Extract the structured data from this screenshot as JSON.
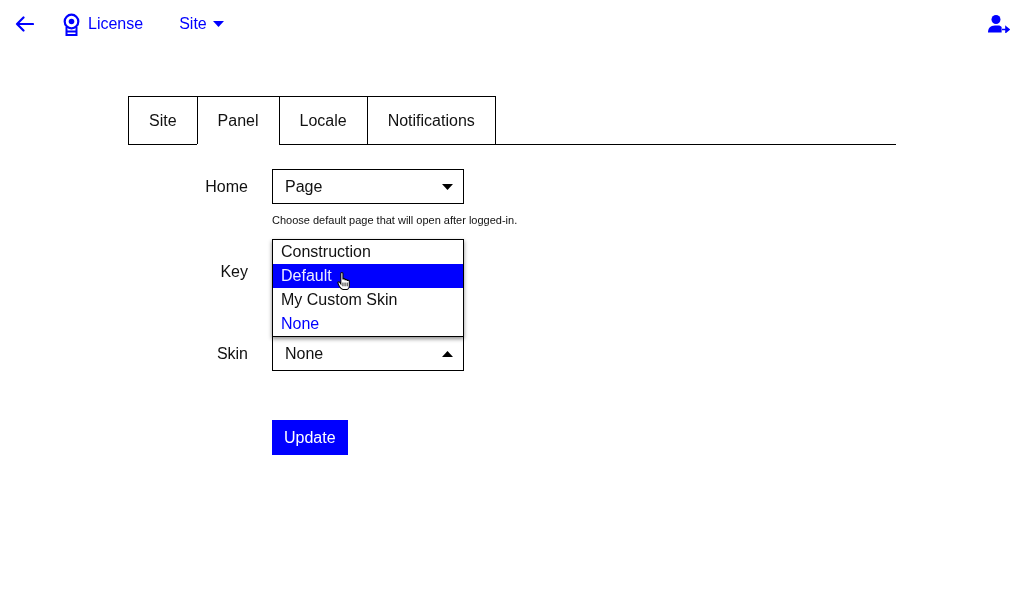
{
  "header": {
    "title": "License",
    "site_menu": "Site"
  },
  "tabs": [
    {
      "label": "Site",
      "selected": false
    },
    {
      "label": "Panel",
      "selected": true
    },
    {
      "label": "Locale",
      "selected": false
    },
    {
      "label": "Notifications",
      "selected": false
    }
  ],
  "form": {
    "fields": [
      {
        "kind": "select",
        "label": "Home",
        "value": "Page",
        "expanded": false,
        "help": "Choose default page that will open after logged-in."
      },
      {
        "kind": "covered",
        "label": "Key"
      },
      {
        "kind": "select",
        "label": "Skin",
        "value": "None",
        "expanded": true,
        "options": [
          {
            "label": "Construction",
            "highlighted": false,
            "selected": false
          },
          {
            "label": "Default",
            "highlighted": true,
            "selected": false
          },
          {
            "label": "My Custom Skin",
            "highlighted": false,
            "selected": false
          },
          {
            "label": "None",
            "highlighted": false,
            "selected": true
          }
        ]
      }
    ],
    "submit": "Update"
  }
}
